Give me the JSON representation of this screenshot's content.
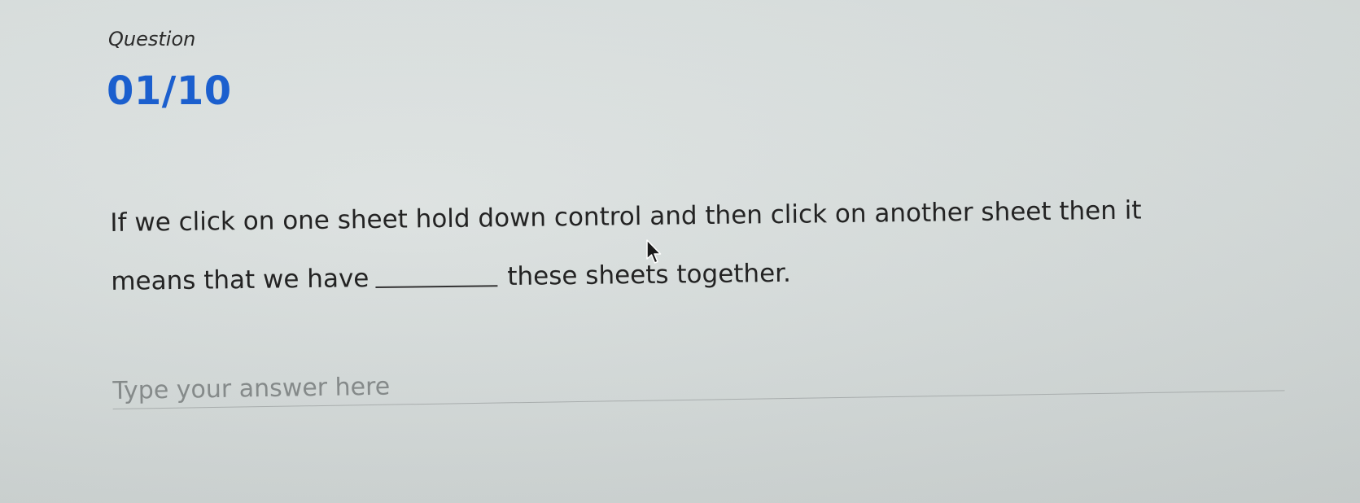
{
  "quiz": {
    "question_label": "Question",
    "counter": "01/10",
    "text_part1": "If we click on one sheet hold down control and then click on another sheet then it means that we have",
    "text_part2": "these sheets together.",
    "answer_placeholder": "Type your answer here",
    "answer_value": ""
  },
  "colors": {
    "accent": "#1b5fce",
    "background": "#d9dfdd",
    "text": "#232323"
  },
  "icons": {
    "pointer": "mouse-pointer-icon"
  }
}
